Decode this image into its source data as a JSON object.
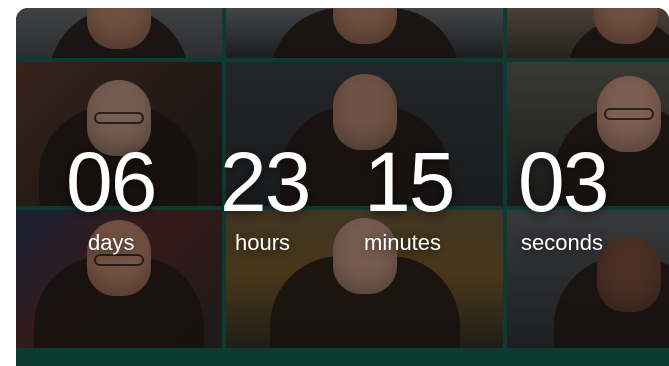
{
  "countdown": {
    "days": {
      "value": "06",
      "label": "days"
    },
    "hours": {
      "value": "23",
      "label": "hours"
    },
    "minutes": {
      "value": "15",
      "label": "minutes"
    },
    "seconds": {
      "value": "03",
      "label": "seconds"
    }
  }
}
